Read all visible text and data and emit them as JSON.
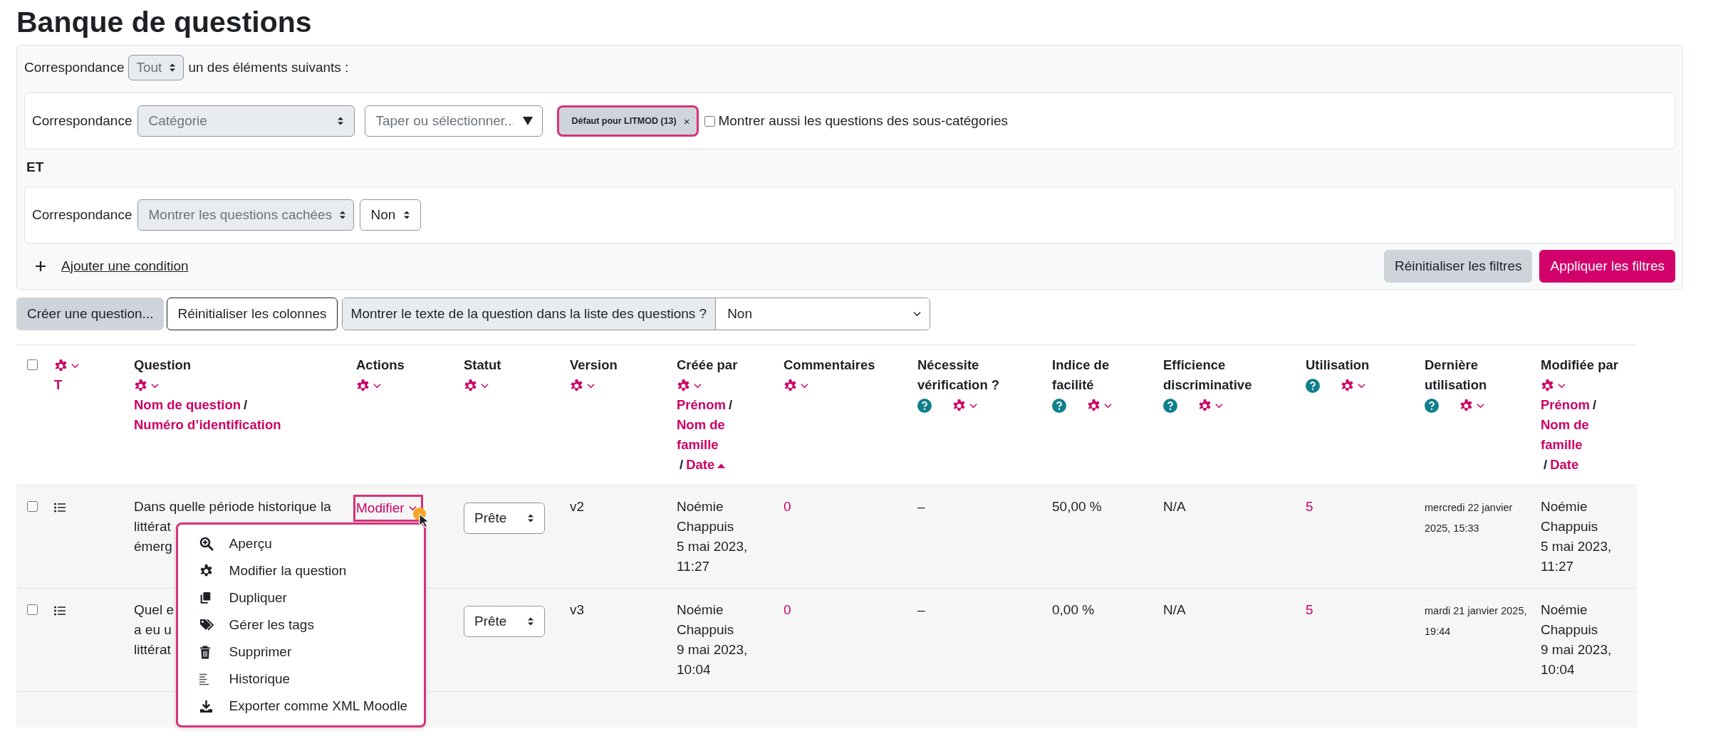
{
  "title": "Banque de questions",
  "filters": {
    "match": {
      "label": "Correspondance",
      "value": "Tout",
      "disabled": true,
      "suffix": "un des éléments suivants :"
    },
    "conditions": [
      {
        "kind": "category",
        "label": "Correspondance",
        "field": "Catégorie",
        "field_disabled": true,
        "search_placeholder": "Taper ou sélectionner...",
        "chip": "Défaut pour LITMOD (13)",
        "chip_remove": "×",
        "subcategories": {
          "label": "Montrer aussi les questions des sous-catégories",
          "checked": false
        }
      },
      {
        "kind": "hidden",
        "label": "Correspondance",
        "field": "Montrer les questions cachées",
        "field_disabled": true,
        "value": "Non"
      }
    ],
    "joiner": "ET",
    "add_condition": "Ajouter une condition",
    "reset_button": "Réinitialiser les filtres",
    "apply_button": "Appliquer les filtres"
  },
  "toolbar": {
    "create_button": "Créer une question...",
    "reset_columns_button": "Réinitialiser les colonnes",
    "show_text_label": "Montrer le texte de la question dans la liste des questions ?",
    "show_text_value": "Non"
  },
  "table": {
    "columns": [
      {
        "kind": "checkbox",
        "checked": false
      },
      {
        "kind": "header",
        "sort": [
          {
            "kind": "link",
            "text": "T",
            "sorted": false
          }
        ]
      },
      {
        "kind": "header",
        "title": "Question",
        "sort": [
          {
            "kind": "link",
            "text": "Nom de question",
            "sorted": false
          },
          {
            "kind": "sep",
            "text": "/"
          },
          {
            "kind": "link",
            "text": "Numéro d’identification",
            "sorted": false
          }
        ]
      },
      {
        "kind": "header",
        "title": "Actions"
      },
      {
        "kind": "header",
        "title": "Statut"
      },
      {
        "kind": "header",
        "title": "Version"
      },
      {
        "kind": "header",
        "title": "Créée par",
        "sort": [
          {
            "kind": "link",
            "text": "Prénom",
            "sorted": false
          },
          {
            "kind": "sep",
            "text": "/"
          },
          {
            "kind": "link",
            "text": "Nom de famille",
            "sorted": false
          },
          {
            "kind": "sep",
            "text": "/"
          },
          {
            "kind": "link",
            "text": "Date",
            "sorted": true
          }
        ]
      },
      {
        "kind": "header",
        "title": "Commentaires"
      },
      {
        "kind": "header",
        "title": "Nécessite vérification ?",
        "help": true
      },
      {
        "kind": "header",
        "title": "Indice de facilité",
        "help": true
      },
      {
        "kind": "header",
        "title": "Efficience discriminative",
        "help": true
      },
      {
        "kind": "header",
        "title": "Utilisation",
        "help": true
      },
      {
        "kind": "header",
        "title": "Dernière utilisation",
        "help": true
      },
      {
        "kind": "header",
        "title": "Modifiée par",
        "sort": [
          {
            "kind": "link",
            "text": "Prénom",
            "sorted": false
          },
          {
            "kind": "sep",
            "text": "/"
          },
          {
            "kind": "link",
            "text": "Nom de famille",
            "sorted": false
          },
          {
            "kind": "sep",
            "text": "/"
          },
          {
            "kind": "link",
            "text": "Date",
            "sorted": false
          }
        ]
      }
    ],
    "rows": [
      {
        "checked": false,
        "question_lines": [
          "Dans quelle période historique la",
          "littérat",
          "émerg"
        ],
        "action": "Modifier",
        "action_focused": true,
        "status": "Prête",
        "version": "v2",
        "created_by": "Noémie Chappuis",
        "created_date": "5 mai 2023, 11:27",
        "comments": "0",
        "needs_check": "–",
        "facility": "50,00 %",
        "discrimination": "N/A",
        "usage": "5",
        "last_used": "mercredi 22 janvier 2025, 15:33",
        "modified_by": "Noémie Chappuis",
        "modified_date": "5 mai 2023, 11:27",
        "actions_menu": [
          {
            "kind": "preview",
            "label": "Aperçu"
          },
          {
            "kind": "edit",
            "label": "Modifier la question"
          },
          {
            "kind": "duplicate",
            "label": "Dupliquer"
          },
          {
            "kind": "tags",
            "label": "Gérer les tags"
          },
          {
            "kind": "delete",
            "label": "Supprimer"
          },
          {
            "kind": "history",
            "label": "Historique"
          },
          {
            "kind": "export",
            "label": "Exporter comme XML Moodle"
          }
        ]
      },
      {
        "checked": false,
        "question_lines": [
          "Quel e",
          "a eu u",
          "littérat"
        ],
        "status": "Prête",
        "version": "v3",
        "created_by": "Noémie Chappuis",
        "created_date": "9 mai 2023, 10:04",
        "comments": "0",
        "needs_check": "–",
        "facility": "0,00 %",
        "discrimination": "N/A",
        "usage": "5",
        "last_used": "mardi 21 janvier 2025, 19:44",
        "modified_by": "Noémie Chappuis",
        "modified_date": "9 mai 2023, 10:04"
      }
    ]
  }
}
